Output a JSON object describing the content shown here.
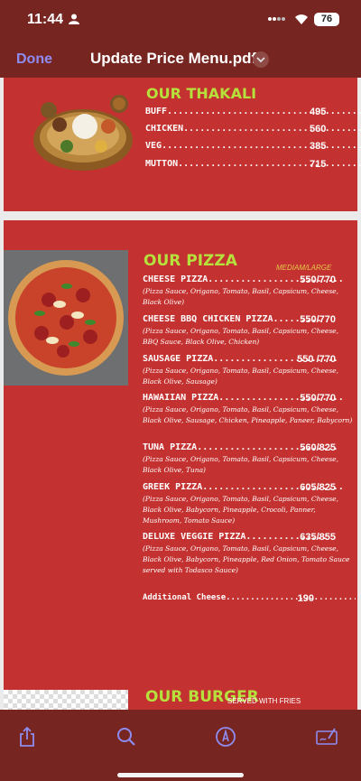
{
  "status_bar": {
    "time": "11:44",
    "battery": "76"
  },
  "nav": {
    "done": "Done",
    "title": "Update Price Menu.pdf"
  },
  "thakali": {
    "title": "OUR THAKALI",
    "items": [
      {
        "name": "BUFF",
        "price": "495"
      },
      {
        "name": "CHICKEN",
        "price": "560"
      },
      {
        "name": "VEG",
        "price": "385"
      },
      {
        "name": "MUTTON",
        "price": "715"
      }
    ]
  },
  "pizza": {
    "title": "OUR PIZZA",
    "size_label": "MEDIAM/LARGE",
    "items": [
      {
        "name": "CHEESE PIZZA",
        "price": "550/770",
        "desc": "(Pizza Sauce, Origano, Tomato, Basil, Capsicum, Cheese, Black Olive)"
      },
      {
        "name": "CHEESE BBQ CHICKEN PIZZA",
        "price": "550/770",
        "desc": "(Pizza Sauce, Origano, Tomato, Basil, Capsicum, Cheese, BBQ Sauce, Black Olive, Chicken)"
      },
      {
        "name": "SAUSAGE PIZZA",
        "price": "550 /770",
        "desc": "(Pizza Sauce, Origano, Tomato, Basil, Capsicum, Cheese, Black Olive, Sausage)"
      },
      {
        "name": "HAWAIIAN PIZZA",
        "price": "550/770",
        "desc": "(Pizza Sauce, Origano, Tomato, Basil, Capsicum, Cheese, Black Olive, Sausage, Chicken, Pineapple, Paneer, Babycorn)"
      },
      {
        "name": "TUNA PIZZA",
        "price": "560/825",
        "desc": "(Pizza Sauce, Origano, Tomato, Basil, Capsicum, Cheese, Black Olive, Tuna)"
      },
      {
        "name": "GREEK PIZZA",
        "price": "605/825",
        "desc": "(Pizza Sauce, Origano, Tomato, Basil, Capsicum, Cheese, Black Olive, Babycorn, Pineapple, Crocoli, Panner, Mushroom, Tomato Sauce)"
      },
      {
        "name": "DELUXE VEGGIE PIZZA",
        "price": "635/855",
        "desc": "(Pizza Sauce, Origano, Tomato, Basil, Capsicum, Cheese, Black Olive, Babycorn, Pineapple, Red Onion, Tomato Sauce served with Todasco Sauce)"
      }
    ],
    "additional": {
      "name": "Additional Cheese",
      "price": "190"
    }
  },
  "burger": {
    "title": "OUR BURGER",
    "subtitle": "SERVED WITH FRIES"
  },
  "toolbar_icons": [
    "share-icon",
    "search-icon",
    "markup-icon",
    "signature-icon"
  ]
}
